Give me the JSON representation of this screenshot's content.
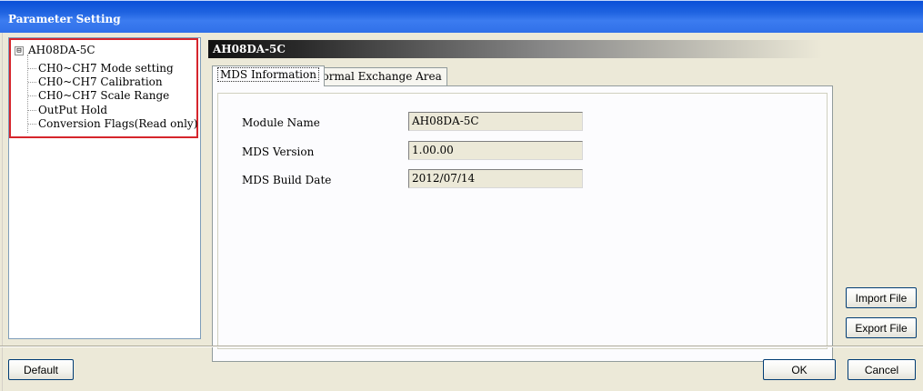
{
  "window": {
    "title": "Parameter Setting"
  },
  "tree": {
    "root": "AH08DA-5C",
    "expander": "⊟",
    "children": [
      "CH0~CH7 Mode setting",
      "CH0~CH7 Calibration",
      "CH0~CH7 Scale Range",
      "OutPut Hold",
      "Conversion Flags(Read only)"
    ]
  },
  "panel": {
    "header": "AH08DA-5C",
    "tabs": [
      "MDS Information",
      "Normal Exchange Area"
    ],
    "active_tab": "MDS Information",
    "fields": [
      {
        "label": "Module Name",
        "value": "AH08DA-5C"
      },
      {
        "label": "MDS Version",
        "value": "1.00.00"
      },
      {
        "label": "MDS Build Date",
        "value": "2012/07/14"
      }
    ]
  },
  "buttons": {
    "import": "Import File",
    "export": "Export File",
    "default": "Default",
    "ok": "OK",
    "cancel": "Cancel"
  },
  "colors": {
    "title_bar": "#0a4fd8",
    "highlight": "#d6252c",
    "dialog_bg": "#ece9d8"
  }
}
